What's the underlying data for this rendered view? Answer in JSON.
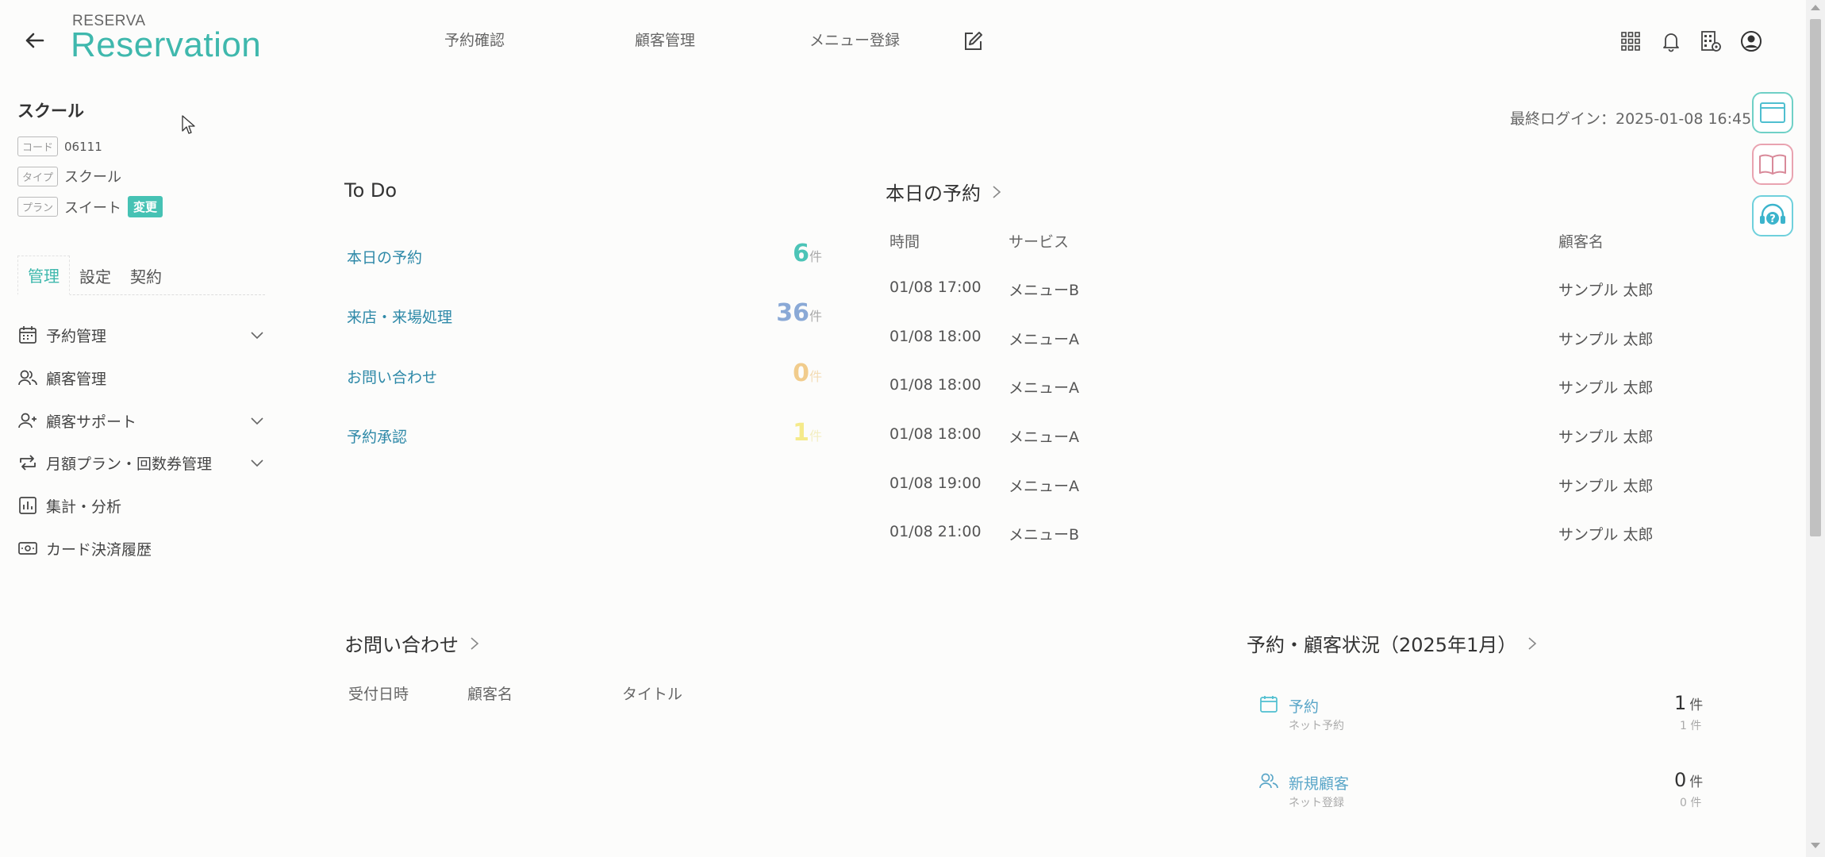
{
  "header": {
    "brand_top": "RESERVA",
    "brand_main": "Reservation",
    "nav": [
      "予約確認",
      "顧客管理",
      "メニュー登録"
    ]
  },
  "last_login": "最終ログイン：2025-01-08 16:45",
  "sidebar": {
    "school_name": "スクール",
    "code_tag": "コード",
    "code_value": "06111",
    "type_tag": "タイプ",
    "type_value": "スクール",
    "plan_tag": "プラン",
    "plan_value": "スイート",
    "change_label": "変更",
    "tabs": [
      "管理",
      "設定",
      "契約"
    ],
    "menu": [
      {
        "label": "予約管理",
        "icon": "calendar-icon"
      },
      {
        "label": "顧客管理",
        "icon": "users-icon"
      },
      {
        "label": "顧客サポート",
        "icon": "user-plus-icon"
      },
      {
        "label": "月額プラン・回数券管理",
        "icon": "repeat-icon"
      },
      {
        "label": "集計・分析",
        "icon": "chart-icon"
      },
      {
        "label": "カード決済履歴",
        "icon": "card-icon"
      }
    ]
  },
  "todo": {
    "title": "To Do",
    "items": [
      {
        "label": "本日の予約",
        "count": "6",
        "unit": "件",
        "color": "#4cc4b7"
      },
      {
        "label": "来店・来場処理",
        "count": "36",
        "unit": "件",
        "color": "#8aa9d6"
      },
      {
        "label": "お問い合わせ",
        "count": "0",
        "unit": "件",
        "color": "#f1cc8c"
      },
      {
        "label": "予約承認",
        "count": "1",
        "unit": "件",
        "color": "#f5ea8a"
      }
    ]
  },
  "today": {
    "title": "本日の予約",
    "headers": [
      "時間",
      "サービス",
      "顧客名"
    ],
    "rows": [
      [
        "01/08 17:00",
        "メニューB",
        "サンプル 太郎"
      ],
      [
        "01/08 18:00",
        "メニューA",
        "サンプル 太郎"
      ],
      [
        "01/08 18:00",
        "メニューA",
        "サンプル 太郎"
      ],
      [
        "01/08 18:00",
        "メニューA",
        "サンプル 太郎"
      ],
      [
        "01/08 19:00",
        "メニューA",
        "サンプル 太郎"
      ],
      [
        "01/08 21:00",
        "メニューB",
        "サンプル 太郎"
      ]
    ]
  },
  "inquiry": {
    "title": "お問い合わせ",
    "headers": [
      "受付日時",
      "顧客名",
      "タイトル"
    ]
  },
  "status": {
    "title": "予約・顧客状況（2025年1月）",
    "items": [
      {
        "label": "予約",
        "sub": "ネット予約",
        "num": "1",
        "unit": "件",
        "subnum": "1 件"
      },
      {
        "label": "新規顧客",
        "sub": "ネット登録",
        "num": "0",
        "unit": "件",
        "subnum": "0 件"
      }
    ]
  },
  "colors": {
    "accent": "#3fb8ad"
  }
}
